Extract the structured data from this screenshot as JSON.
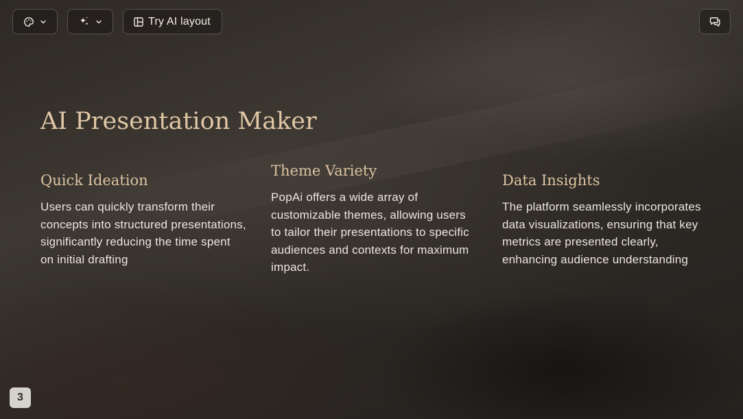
{
  "toolbar": {
    "theme_icon": "palette-icon",
    "ai_icon": "sparkles-icon",
    "layout_icon": "layout-icon",
    "layout_label": "Try AI layout",
    "comment_icon": "comments-icon",
    "dropdown_icon": "chevron-down-icon"
  },
  "slide": {
    "title": "AI Presentation Maker",
    "columns": [
      {
        "heading": "Quick Ideation",
        "body": "Users can quickly transform their concepts into structured presentations, significantly reducing the time spent on initial drafting"
      },
      {
        "heading": "Theme Variety",
        "body": "PopAi offers a wide array of customizable themes, allowing users to tailor their presentations to specific audiences and contexts for maximum impact."
      },
      {
        "heading": "Data Insights",
        "body": "The platform seamlessly incorporates data visualizations, ensuring that key metrics are presented clearly, enhancing audience understanding"
      }
    ],
    "page_number": "3"
  },
  "colors": {
    "title": "#e0c7a6",
    "heading": "#dcc3a2",
    "body_text": "#ece6de",
    "background": "#2f2a25"
  }
}
